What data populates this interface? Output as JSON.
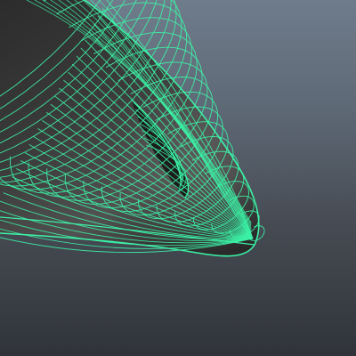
{
  "viewport": {
    "background_top": "#6f7c8b",
    "background_bottom": "#30333a"
  },
  "mesh": {
    "object": "nurbs-surface",
    "display_mode": "shaded-wireframe",
    "selected": true,
    "wire_color": "#3cf2a6",
    "surface_color": "#3a3a3a",
    "surface_highlight": "#595959",
    "cavity_color": "#1c1c1c"
  }
}
